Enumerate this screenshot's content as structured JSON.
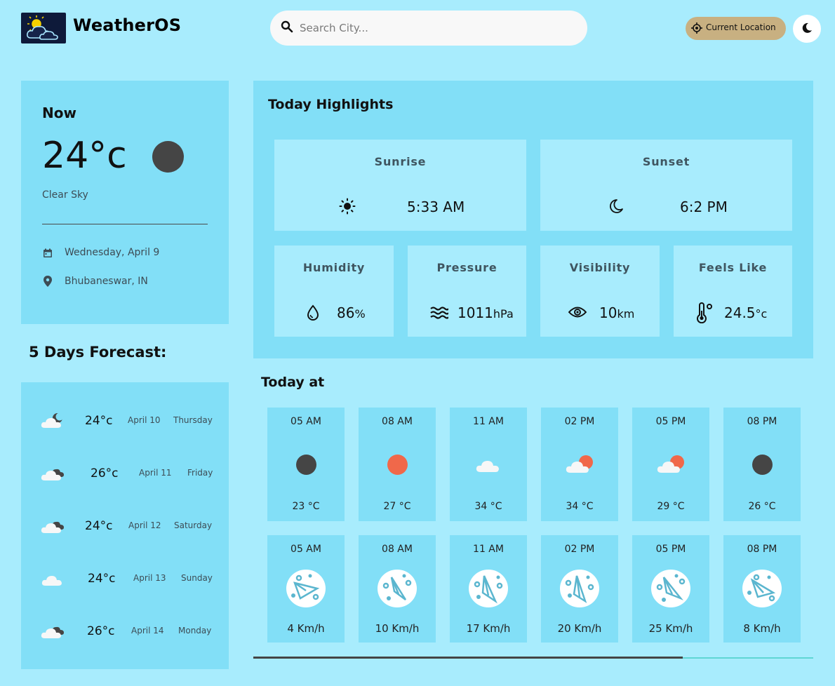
{
  "header": {
    "app_name": "WeatherOS",
    "search_placeholder": "Search City...",
    "location_button": "Current Location",
    "icons": [
      "app-logo",
      "search-icon",
      "crosshair-icon",
      "moon-icon"
    ]
  },
  "now": {
    "title": "Now",
    "temp": "24",
    "temp_unit": "°c",
    "description": "Clear Sky",
    "date": "Wednesday, April 9",
    "location": "Bhubaneswar, IN",
    "icon_color": "#454545"
  },
  "forecast": {
    "title": "5 Days Forecast:",
    "days": [
      {
        "temp": "24",
        "unit": "°c",
        "date": "April 10",
        "day": "Thursday",
        "icon": "night-cloud-icon"
      },
      {
        "temp": "26",
        "unit": "°c",
        "date": "April 11",
        "day": "Friday",
        "icon": "clouds-icon"
      },
      {
        "temp": "24",
        "unit": "°c",
        "date": "April 12",
        "day": "Saturday",
        "icon": "clouds-icon"
      },
      {
        "temp": "24",
        "unit": "°c",
        "date": "April 13",
        "day": "Sunday",
        "icon": "cloud-icon"
      },
      {
        "temp": "26",
        "unit": "°c",
        "date": "April 14",
        "day": "Monday",
        "icon": "clouds-icon"
      }
    ]
  },
  "highlights": {
    "title": "Today Highlights",
    "sunrise": {
      "label": "Sunrise",
      "value": "5:33 AM"
    },
    "sunset": {
      "label": "Sunset",
      "value": "6:2 PM"
    },
    "humidity": {
      "label": "Humidity",
      "value": "86",
      "unit": "%"
    },
    "pressure": {
      "label": "Pressure",
      "value": "1011",
      "unit": "hPa"
    },
    "visibility": {
      "label": "Visibility",
      "value": "10",
      "unit": "km"
    },
    "feels_like": {
      "label": "Feels Like",
      "value": "24.5",
      "unit": "°c"
    }
  },
  "today_at": {
    "title": "Today at",
    "hours": [
      {
        "time": "05 AM",
        "temp": "23 °C",
        "icon": "night-clear-icon"
      },
      {
        "time": "08 AM",
        "temp": "27 °C",
        "icon": "sun-icon"
      },
      {
        "time": "11 AM",
        "temp": "34 °C",
        "icon": "cloud-icon"
      },
      {
        "time": "02 PM",
        "temp": "34 °C",
        "icon": "sun-cloud-icon"
      },
      {
        "time": "05 PM",
        "temp": "29 °C",
        "icon": "sun-cloud-icon"
      },
      {
        "time": "08 PM",
        "temp": "26 °C",
        "icon": "night-clear-icon"
      }
    ],
    "wind": [
      {
        "time": "05 AM",
        "speed": "4 Km/h"
      },
      {
        "time": "08 AM",
        "speed": "10 Km/h"
      },
      {
        "time": "11 AM",
        "speed": "17 Km/h"
      },
      {
        "time": "02 PM",
        "speed": "20 Km/h"
      },
      {
        "time": "05 PM",
        "speed": "25 Km/h"
      },
      {
        "time": "08 PM",
        "speed": "8 Km/h"
      }
    ]
  },
  "colors": {
    "page_bg": "#a8ecfd",
    "panel_bg": "#82dff7",
    "location_button": "#c8b081",
    "sun": "#f0684a",
    "night": "#454545"
  }
}
